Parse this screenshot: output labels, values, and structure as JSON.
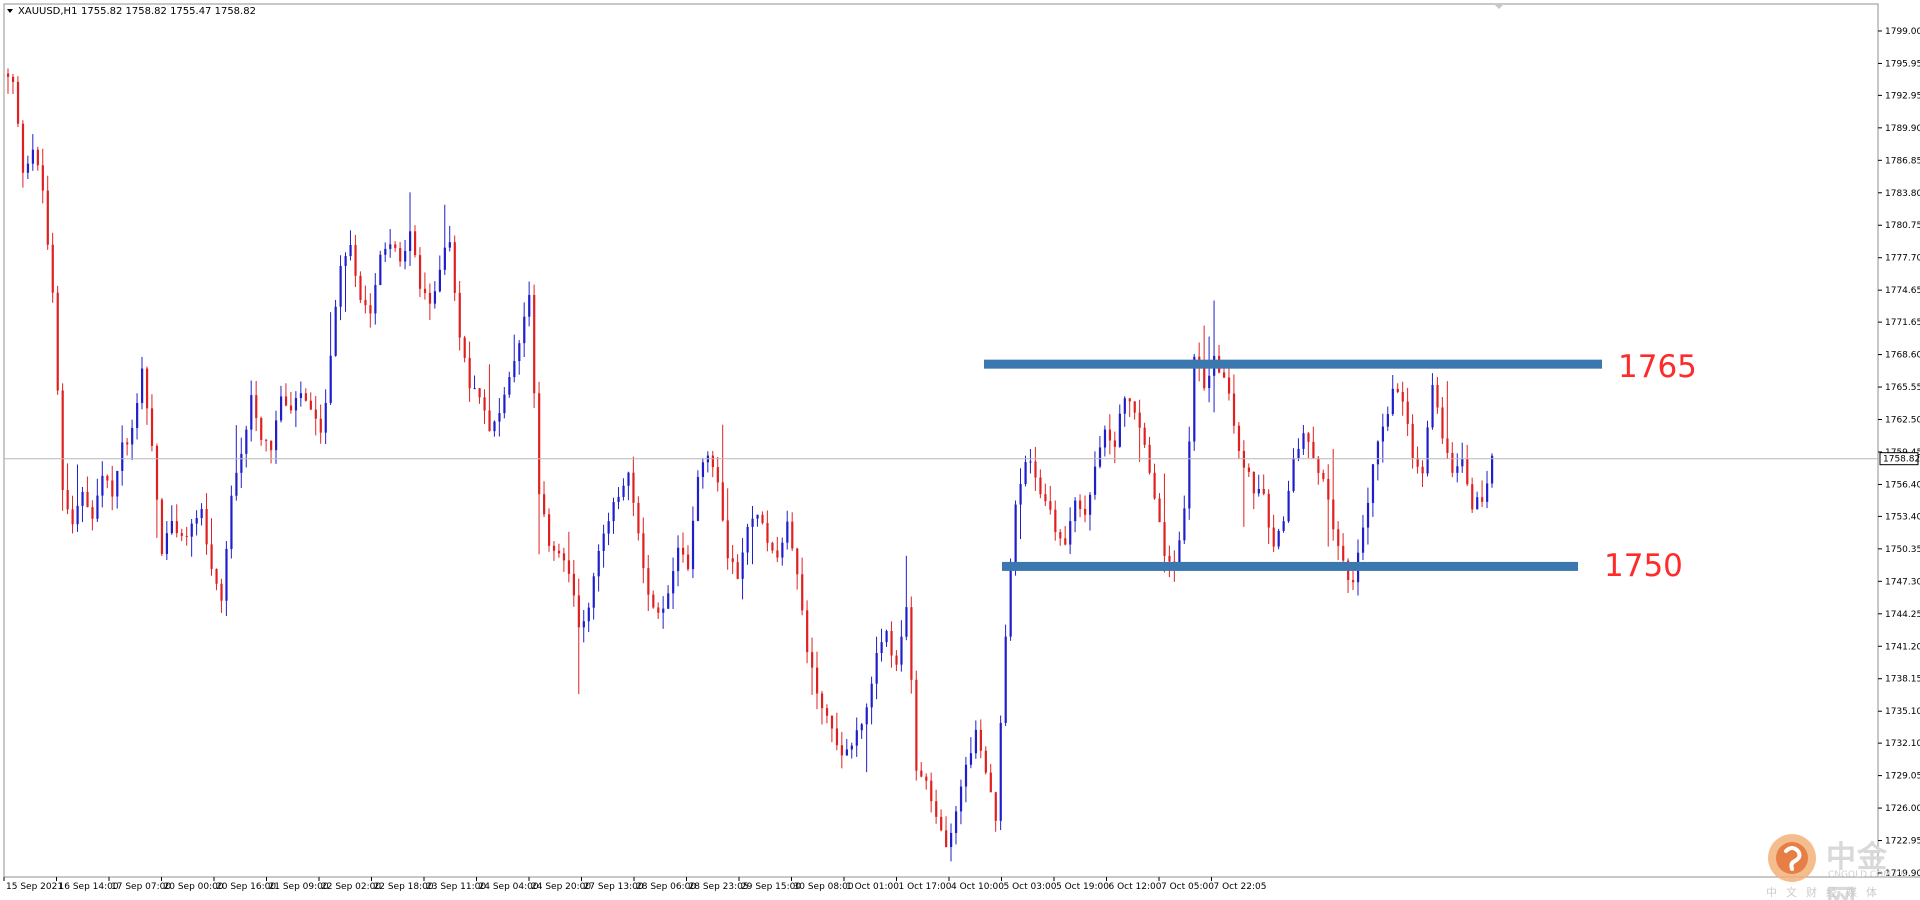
{
  "header": {
    "symbol": "XAUUSD,H1",
    "ohlc": "1755.82 1758.82 1755.47 1758.82",
    "menu_icon": "triangle-down-icon"
  },
  "current_price": "1758.82",
  "colors": {
    "bull": "#1e1ecc",
    "bear": "#e02020",
    "level": "#3b78b0",
    "level_label": "#ff2a2a"
  },
  "levels": [
    {
      "label": "1765",
      "price": 1767.7,
      "x0": "30 Sep 08:00",
      "x1": "7 Oct 22:05"
    },
    {
      "label": "1750",
      "price": 1748.7,
      "x0": "30 Sep 08:00",
      "x1": "7 Oct 22:05"
    }
  ],
  "watermark": {
    "logo": "cngold-logo-icon",
    "name": "中金网",
    "url": "CNGOLD.COM.CN",
    "slogan": "中文财经媒体"
  },
  "chart_data": {
    "type": "candlestick",
    "title": "",
    "symbol": "XAUUSD",
    "timeframe": "H1",
    "ylim": [
      1719.9,
      1800.5
    ],
    "y_ticks": [
      "1799.00",
      "1795.95",
      "1792.95",
      "1789.90",
      "1786.85",
      "1783.80",
      "1780.75",
      "1777.70",
      "1774.65",
      "1771.65",
      "1768.60",
      "1765.55",
      "1762.50",
      "1759.45",
      "1756.40",
      "1753.40",
      "1750.35",
      "1747.30",
      "1744.25",
      "1741.20",
      "1738.15",
      "1735.10",
      "1732.10",
      "1729.05",
      "1726.00",
      "1722.95",
      "1719.90"
    ],
    "x_ticks": [
      "15 Sep 2021",
      "16 Sep 14:00",
      "17 Sep 07:00",
      "20 Sep 00:00",
      "20 Sep 16:00",
      "21 Sep 09:00",
      "22 Sep 02:00",
      "22 Sep 18:00",
      "23 Sep 11:00",
      "24 Sep 04:00",
      "24 Sep 20:00",
      "27 Sep 13:00",
      "28 Sep 06:00",
      "28 Sep 23:05",
      "29 Sep 15:00",
      "30 Sep 08:00",
      "1 Oct 01:00",
      "1 Oct 17:00",
      "4 Oct 10:00",
      "5 Oct 03:00",
      "5 Oct 19:00",
      "6 Oct 12:00",
      "7 Oct 05:00",
      "7 Oct 22:05"
    ],
    "grid": false,
    "price_line": 1758.82,
    "path": [
      1795,
      1794,
      1786,
      1788,
      1784,
      1774,
      1756,
      1753,
      1755.5,
      1753,
      1757,
      1755.5,
      1760,
      1761.5,
      1767.5,
      1760,
      1750,
      1753,
      1751,
      1752.5,
      1754,
      1748,
      1745,
      1755,
      1759,
      1765,
      1761,
      1760,
      1764.5,
      1763,
      1765,
      1763,
      1761,
      1768,
      1777,
      1779,
      1774,
      1773,
      1778,
      1779.5,
      1777,
      1780,
      1775,
      1773,
      1777,
      1779.5,
      1770,
      1766,
      1765,
      1762,
      1763,
      1766,
      1770,
      1774,
      1755,
      1751,
      1750,
      1748,
      1743,
      1745,
      1750,
      1753,
      1755.5,
      1757,
      1752,
      1746,
      1744,
      1746,
      1750,
      1749,
      1757.5,
      1759.5,
      1757,
      1750,
      1748,
      1752,
      1754,
      1751,
      1750,
      1753,
      1748,
      1741,
      1737,
      1734.5,
      1732,
      1731,
      1733.5,
      1735,
      1740,
      1742.5,
      1739,
      1745,
      1730,
      1728,
      1725,
      1722.5,
      1726,
      1730,
      1733,
      1729,
      1725,
      1742,
      1755,
      1759,
      1757,
      1755,
      1752,
      1751,
      1755,
      1753,
      1758,
      1761,
      1760.5,
      1765,
      1763,
      1760,
      1755,
      1750,
      1748.5,
      1754,
      1768,
      1766,
      1768,
      1767,
      1762,
      1758,
      1756,
      1755,
      1750,
      1753,
      1759,
      1761,
      1759,
      1757,
      1752.5,
      1749,
      1747,
      1752,
      1758,
      1762,
      1765,
      1764,
      1759,
      1757,
      1766,
      1761,
      1758,
      1759,
      1754.5,
      1755,
      1758.8
    ]
  }
}
